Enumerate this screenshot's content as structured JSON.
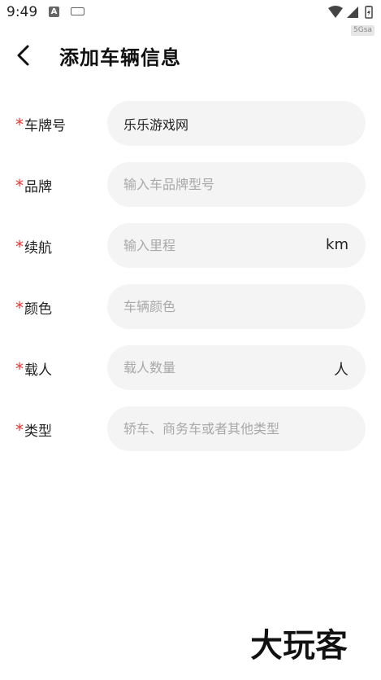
{
  "status_bar": {
    "time": "9:49",
    "speed_badge": "5Gsa"
  },
  "header": {
    "title": "添加车辆信息"
  },
  "form": {
    "required_mark": "*",
    "fields": [
      {
        "label": "车牌号",
        "value": "乐乐游戏网",
        "placeholder": "",
        "unit": ""
      },
      {
        "label": "品牌",
        "value": "",
        "placeholder": "输入车品牌型号",
        "unit": ""
      },
      {
        "label": "续航",
        "value": "",
        "placeholder": "输入里程",
        "unit": "km"
      },
      {
        "label": "颜色",
        "value": "",
        "placeholder": "车辆颜色",
        "unit": ""
      },
      {
        "label": "载人",
        "value": "",
        "placeholder": "载人数量",
        "unit": "人"
      },
      {
        "label": "类型",
        "value": "",
        "placeholder": "轿车、商务车或者其他类型",
        "unit": ""
      }
    ]
  },
  "watermark": {
    "text": "大玩客"
  },
  "colors": {
    "required": "#e53935",
    "field_bg": "#f4f4f4",
    "placeholder": "#a8a8a8"
  }
}
